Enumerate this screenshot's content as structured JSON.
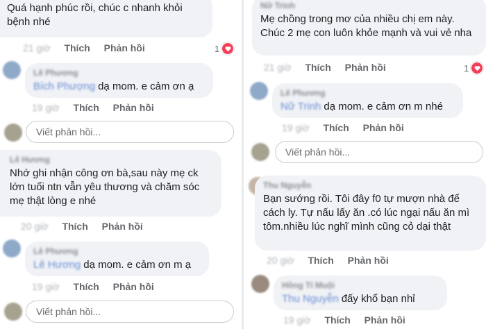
{
  "labels": {
    "like": "Thích",
    "reply": "Phản hồi",
    "reply_placeholder": "Viết phản hồi..."
  },
  "left": {
    "c1": {
      "text": "Quá hạnh phúc rồi, chúc c nhanh khỏi bệnh nhé",
      "time": "21 giờ",
      "reactions": "1"
    },
    "r1": {
      "author": "Lê Phương",
      "tag": "Bích Phượng",
      "text": "dạ mom. e cảm ơn ạ",
      "time": "19 giờ"
    },
    "c2": {
      "author": "Lê Hương",
      "text": "Nhớ ghi nhận công ơn bà,sau này mẹ ck lớn tuổi ntn vẫn yêu thương và chăm sóc mẹ thật lòng e nhé",
      "time": "20 giờ"
    },
    "r2": {
      "author": "Lê Phương",
      "tag": "Lê Hương",
      "text": "dạ mom. e cảm ơn m ạ",
      "time": "19 giờ"
    }
  },
  "right": {
    "c1": {
      "author": "Nữ Trinh",
      "text": "Mẹ chồng trong mơ của nhiều chị em này. Chúc 2 mẹ con luôn khỏe mạnh và vui vẻ nha",
      "time": "21 giờ",
      "reactions": "1"
    },
    "r1": {
      "author": "Lê Phương",
      "tag": "Nữ Trinh",
      "text": "dạ mom. e cảm ơn m nhé",
      "time": "19 giờ"
    },
    "c2": {
      "author": "Thu Nguyễn",
      "text": "Bạn sướng rồi. Tôi đây f0 tự mượn nhà để cách ly. Tự nấu lấy ăn .có lúc ngại nấu ăn mì tôm.nhiều lúc nghĩ mình cũng cỏ dại thật",
      "time": "20 giờ"
    },
    "r2": {
      "author": "Hồng Tí Muội",
      "tag": "Thu Nguyễn",
      "text": "đấy khổ bạn nhỉ",
      "time": "19 giờ"
    }
  },
  "colors": {
    "bubble": "#f0f2f5",
    "heart": "#f33e58",
    "mention": "#6b8fd6"
  },
  "icons": {
    "reaction": "heart-icon"
  }
}
